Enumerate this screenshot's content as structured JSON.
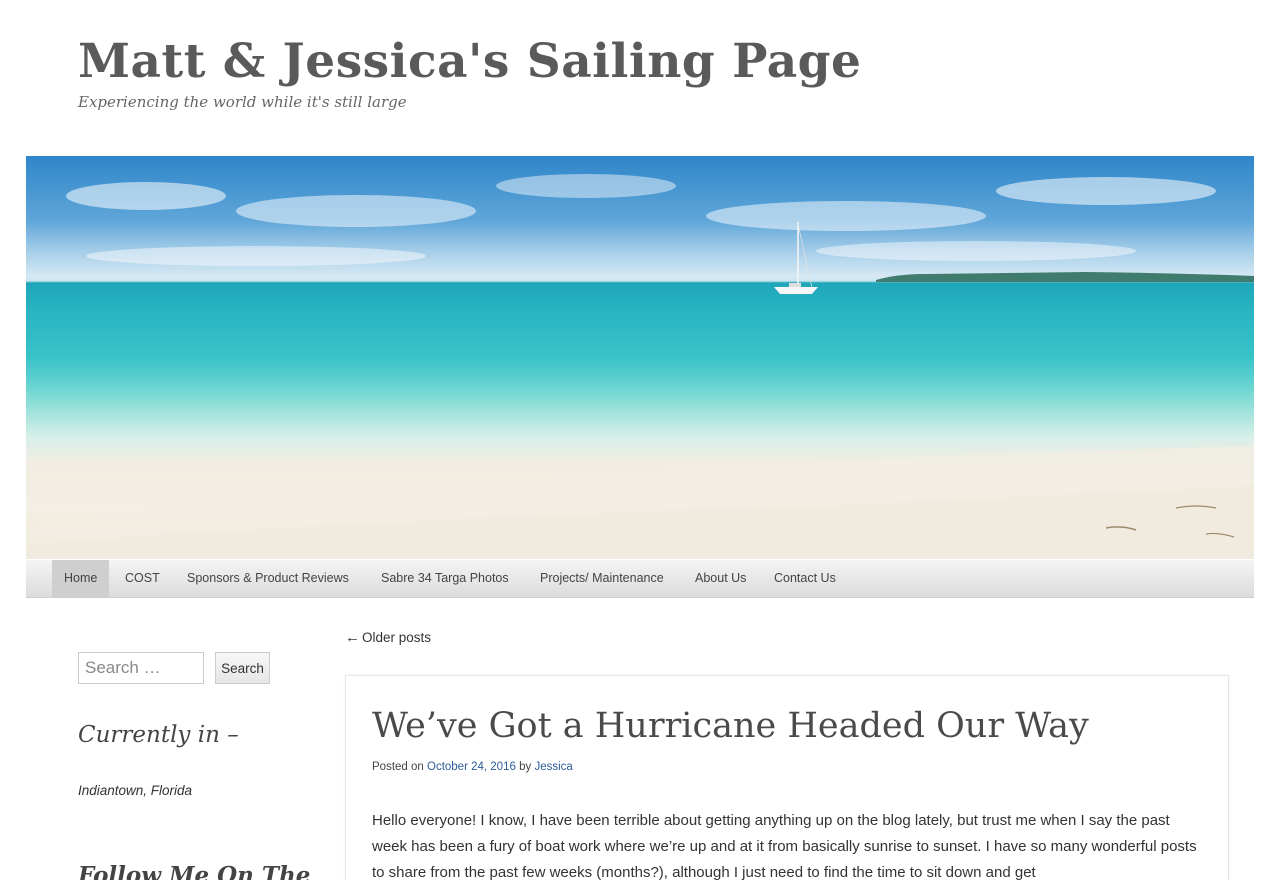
{
  "site": {
    "title": "Matt & Jessica's Sailing Page",
    "description": "Experiencing the world while it's still large"
  },
  "nav": {
    "items": [
      {
        "label": "Home"
      },
      {
        "label": "COST"
      },
      {
        "label": "Sponsors & Product Reviews"
      },
      {
        "label": "Sabre 34 Targa Photos"
      },
      {
        "label": "Projects/ Maintenance"
      },
      {
        "label": "About Us"
      },
      {
        "label": "Contact Us"
      }
    ],
    "active": "Home"
  },
  "sidebar": {
    "search_placeholder": "Search …",
    "search_button": "Search",
    "widget1_title": "Currently in –",
    "widget1_text": "Indiantown, Florida",
    "widget2_title": "Follow Me On The"
  },
  "posts_nav": {
    "older_arrow": "←",
    "older_label": "Older posts"
  },
  "post": {
    "title": "We’ve Got a Hurricane Headed Our Way",
    "posted_on": "Posted on",
    "date": "October 24, 2016",
    "by": "by",
    "author": "Jessica",
    "body": "Hello everyone!  I know, I have been terrible about getting anything up on the blog lately, but trust me when I say the past week has been a fury of boat work where we’re up and at it from basically sunrise to sunset.  I have so many wonderful posts to share from the past few weeks (months?), although I just need to find the time to sit down and get"
  },
  "colors": {
    "link": "#2f5d9a",
    "nav_bg": "#e4e4e4",
    "nav_active": "#cfcfcf",
    "title_gray": "#5a5a5a"
  }
}
